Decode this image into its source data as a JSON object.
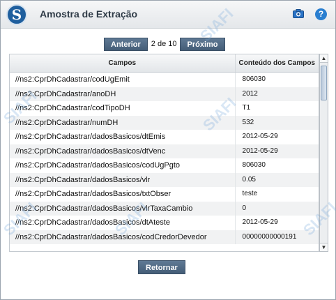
{
  "window": {
    "title": "Amostra de Extração"
  },
  "header": {
    "logo_letter": "S",
    "help_symbol": "?"
  },
  "pager": {
    "prev_label": "Anterior",
    "page_info": "2 de 10",
    "next_label": "Próximo"
  },
  "grid": {
    "columns": [
      "Campos",
      "Conteúdo dos Campos"
    ],
    "rows": [
      [
        "//ns2:CprDhCadastrar/codUgEmit",
        "806030"
      ],
      [
        "//ns2:CprDhCadastrar/anoDH",
        "2012"
      ],
      [
        "//ns2:CprDhCadastrar/codTipoDH",
        "T1"
      ],
      [
        "//ns2:CprDhCadastrar/numDH",
        "532"
      ],
      [
        "//ns2:CprDhCadastrar/dadosBasicos/dtEmis",
        "2012-05-29"
      ],
      [
        "//ns2:CprDhCadastrar/dadosBasicos/dtVenc",
        "2012-05-29"
      ],
      [
        "//ns2:CprDhCadastrar/dadosBasicos/codUgPgto",
        "806030"
      ],
      [
        "//ns2:CprDhCadastrar/dadosBasicos/vlr",
        "0.05"
      ],
      [
        "//ns2:CprDhCadastrar/dadosBasicos/txtObser",
        "teste"
      ],
      [
        "//ns2:CprDhCadastrar/dadosBasicos/vlrTaxaCambio",
        "0"
      ],
      [
        "//ns2:CprDhCadastrar/dadosBasicos/dtAteste",
        "2012-05-29"
      ],
      [
        "//ns2:CprDhCadastrar/dadosBasicos/codCredorDevedor",
        "00000000000191"
      ]
    ]
  },
  "footer": {
    "return_label": "Retornar"
  },
  "watermark": {
    "text": "SIAFI"
  },
  "colors": {
    "button": "#4f6985",
    "header_bg": "#e4e7ea",
    "row_alt": "#f1f2f3"
  },
  "icons": {
    "camera": "camera-icon",
    "help": "help-icon",
    "logo": "siafi-logo-icon"
  }
}
